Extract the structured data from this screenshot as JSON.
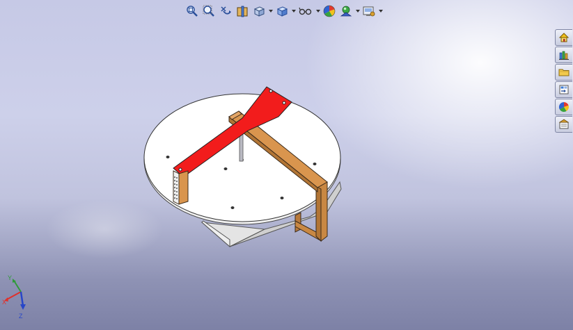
{
  "toolbar": {
    "buttons": [
      {
        "id": "zoom-to-fit",
        "icon": "zoom-to-fit-icon",
        "dropdown": false
      },
      {
        "id": "zoom-to-area",
        "icon": "zoom-to-area-icon",
        "dropdown": false
      },
      {
        "id": "previous-view",
        "icon": "previous-view-icon",
        "dropdown": false
      },
      {
        "id": "section-view",
        "icon": "section-view-icon",
        "dropdown": false
      },
      {
        "id": "view-orientation",
        "icon": "view-orientation-icon",
        "dropdown": true
      },
      {
        "id": "display-style",
        "icon": "display-style-icon",
        "dropdown": true
      },
      {
        "id": "hide-show-items",
        "icon": "hide-show-items-icon",
        "dropdown": true
      },
      {
        "id": "edit-appearance",
        "icon": "edit-appearance-icon",
        "dropdown": false
      },
      {
        "id": "apply-scene",
        "icon": "apply-scene-icon",
        "dropdown": true
      },
      {
        "id": "view-settings",
        "icon": "view-settings-icon",
        "dropdown": true
      }
    ]
  },
  "task_pane": {
    "tabs": [
      {
        "id": "resources",
        "icon": "home-icon"
      },
      {
        "id": "design-library",
        "icon": "design-library-icon"
      },
      {
        "id": "file-explorer",
        "icon": "folder-icon"
      },
      {
        "id": "view-palette",
        "icon": "view-palette-icon"
      },
      {
        "id": "appearances",
        "icon": "appearances-icon"
      },
      {
        "id": "custom-properties",
        "icon": "custom-properties-icon"
      }
    ]
  },
  "triad": {
    "x_label": "X",
    "y_label": "Y",
    "z_label": "Z"
  },
  "colors": {
    "arm": "#f21c1c",
    "frame": "#d9954e",
    "disc": "#ffffff",
    "base": "#ececec",
    "triad_x": "#e0302a",
    "triad_y": "#2f9a3a",
    "triad_z": "#2746c8"
  }
}
